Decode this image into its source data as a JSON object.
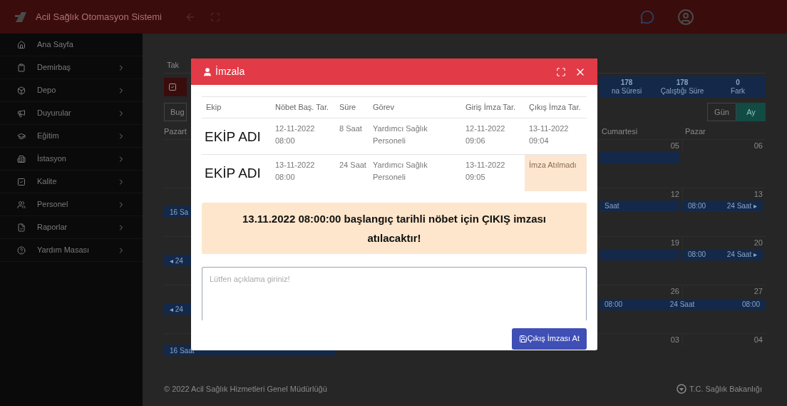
{
  "header": {
    "title": "Acil Sağlık Otomasyon Sistemi"
  },
  "sidebar": {
    "items": [
      {
        "label": "Ana Sayfa",
        "expandable": false
      },
      {
        "label": "Demirbaş",
        "expandable": true
      },
      {
        "label": "Depo",
        "expandable": true
      },
      {
        "label": "Duyurular",
        "expandable": true
      },
      {
        "label": "Eğitim",
        "expandable": true
      },
      {
        "label": "İstasyon",
        "expandable": true
      },
      {
        "label": "Kalite",
        "expandable": true
      },
      {
        "label": "Personel",
        "expandable": true
      },
      {
        "label": "Raporlar",
        "expandable": true
      },
      {
        "label": "Yardım Masası",
        "expandable": true
      }
    ]
  },
  "background": {
    "tab": "Tak",
    "filter": {
      "checked": true
    },
    "today_button": "Bug",
    "stats": [
      {
        "value": "178",
        "label": "na Süresi"
      },
      {
        "value": "178",
        "label": "Çalıştığı Süre"
      },
      {
        "value": "0",
        "label": "Fark"
      }
    ],
    "view_buttons": [
      {
        "label": "Gün",
        "selected": false
      },
      {
        "label": "Ay",
        "selected": true
      }
    ],
    "day_headers": {
      "left": "Pazart",
      "right": [
        "Cumartesi",
        "Pazar"
      ]
    },
    "weeks": [
      {
        "days": [
          {
            "number": "05",
            "bar": {
              "kind": "event"
            }
          },
          {
            "number": "06"
          }
        ]
      },
      {
        "left": "16 Sa",
        "days": [
          {
            "number": "12",
            "bar": {
              "text": [
                "Saat"
              ]
            }
          },
          {
            "number": "13",
            "bar": {
              "text": [
                "08:00",
                "24 Saat ▸"
              ]
            }
          }
        ]
      },
      {
        "left": "◂ 24",
        "days": [
          {
            "number": "19",
            "bar": {
              "kind": "event"
            }
          },
          {
            "number": "20",
            "bar": {
              "text": [
                "08:00",
                "24 Saat ▸"
              ]
            }
          }
        ]
      },
      {
        "left": "◂ 24",
        "span": [
          "08:00",
          "24 Saat",
          "08:00"
        ],
        "days": [
          {
            "number": "26"
          },
          {
            "number": "27"
          }
        ]
      },
      {
        "left_wide": "16 Saat",
        "days": [
          {
            "number": "03"
          },
          {
            "number": "04"
          }
        ]
      }
    ],
    "footer": {
      "copyright": "© 2022 Acil Sağlık Hizmetleri Genel Müdürlüğü",
      "ministry": "T.C. Sağlık Bakanlığı"
    }
  },
  "modal": {
    "title": "İmzala",
    "columns": [
      "Ekip",
      "Nöbet Baş. Tar.",
      "Süre",
      "Görev",
      "Giriş İmza Tar.",
      "Çıkış İmza Tar."
    ],
    "rows": [
      {
        "team": "EKİP ADI",
        "start": "12-11-2022 08:00",
        "duration": "8 Saat",
        "role": "Yardımcı Sağlık Personeli",
        "entry_signed": "12-11-2022 09:06",
        "exit_signed": {
          "text": "13-11-2022 09:04",
          "missing": false
        }
      },
      {
        "team": "EKİP ADI",
        "start": "13-11-2022 08:00",
        "duration": "24 Saat",
        "role": "Yardımcı Sağlık Personeli",
        "entry_signed": "13-11-2022 09:05",
        "exit_signed": {
          "text": "İmza Atılmadı",
          "missing": true
        }
      }
    ],
    "alert": "13.11.2022 08:00:00 başlangıç tarihli nöbet için ÇIKIŞ imzası atılacaktır!",
    "note_field": {
      "placeholder": "Lütfen açıklama giriniz!"
    },
    "submit_button": "Çıkış İmzası At"
  }
}
